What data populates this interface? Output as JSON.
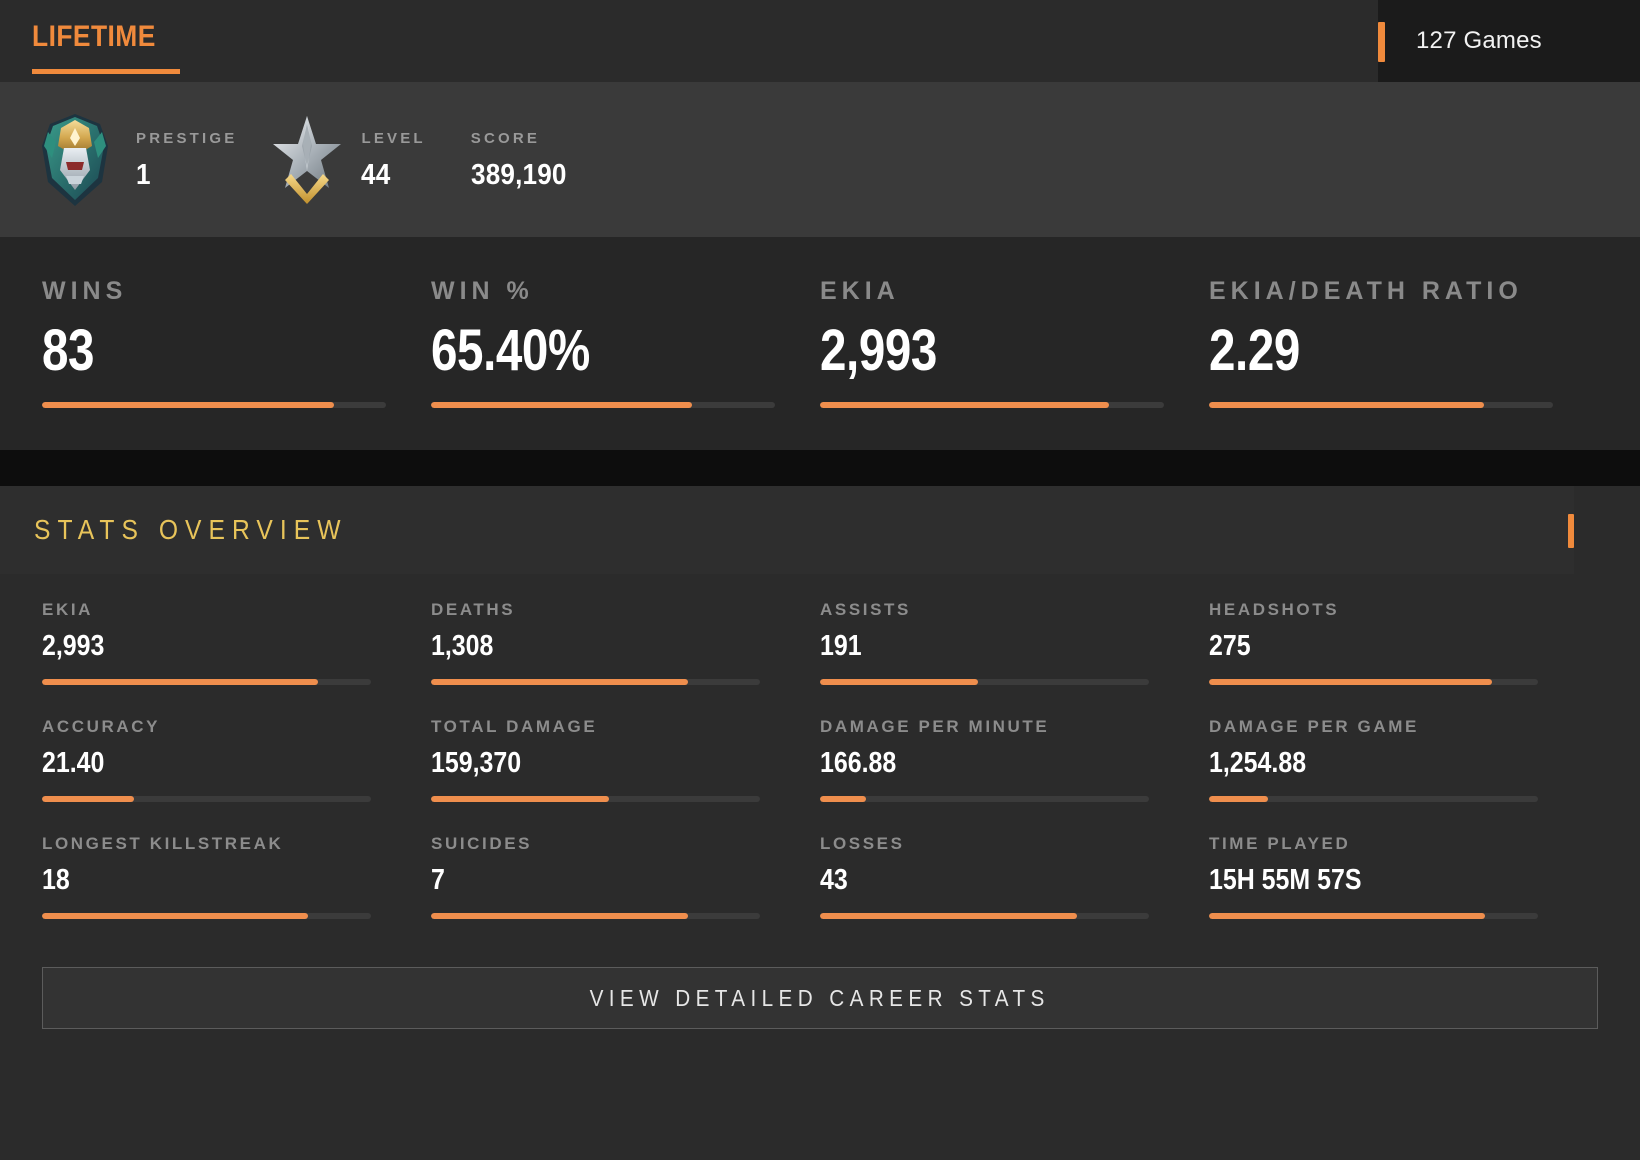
{
  "header": {
    "tab_label": "LIFETIME",
    "games_label": "127 Games",
    "accent_color": "#f08a3c"
  },
  "profile": {
    "prestige_label": "PRESTIGE",
    "prestige_value": "1",
    "level_label": "LEVEL",
    "level_value": "44",
    "score_label": "SCORE",
    "score_value": "389,190",
    "prestige_icon": "prestige-emblem-icon",
    "level_icon": "level-star-icon"
  },
  "hero_stats": [
    {
      "label": "WINS",
      "value": "83",
      "fill": 85
    },
    {
      "label": "WIN %",
      "value": "65.40%",
      "fill": 76
    },
    {
      "label": "EKIA",
      "value": "2,993",
      "fill": 84
    },
    {
      "label": "EKIA/DEATH RATIO",
      "value": "2.29",
      "fill": 80
    }
  ],
  "overview": {
    "title": "STATS OVERVIEW",
    "title_color": "#e8c45a",
    "accent_color": "#f08a3c"
  },
  "stats": [
    {
      "label": "EKIA",
      "value": "2,993",
      "fill": 84
    },
    {
      "label": "DEATHS",
      "value": "1,308",
      "fill": 78
    },
    {
      "label": "ASSISTS",
      "value": "191",
      "fill": 48
    },
    {
      "label": "HEADSHOTS",
      "value": "275",
      "fill": 86
    },
    {
      "label": "ACCURACY",
      "value": "21.40",
      "fill": 28
    },
    {
      "label": "TOTAL DAMAGE",
      "value": "159,370",
      "fill": 54
    },
    {
      "label": "DAMAGE PER MINUTE",
      "value": "166.88",
      "fill": 14
    },
    {
      "label": "DAMAGE PER GAME",
      "value": "1,254.88",
      "fill": 18
    },
    {
      "label": "LONGEST KILLSTREAK",
      "value": "18",
      "fill": 81
    },
    {
      "label": "SUICIDES",
      "value": "7",
      "fill": 78
    },
    {
      "label": "LOSSES",
      "value": "43",
      "fill": 78
    },
    {
      "label": "TIME PLAYED",
      "value": "15H 55M 57S",
      "fill": 84
    }
  ],
  "cta": {
    "label": "VIEW DETAILED CAREER STATS"
  }
}
